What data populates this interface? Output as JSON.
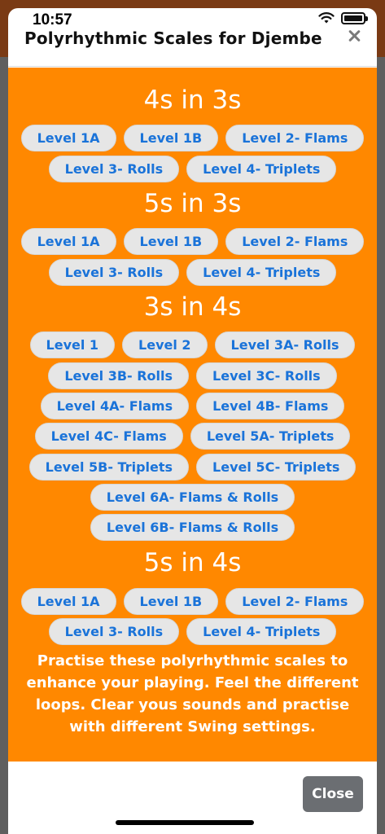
{
  "status": {
    "time": "10:57"
  },
  "modal": {
    "title": "Polyrhythmic Scales for Djembe",
    "close_label": "Close"
  },
  "sections": [
    {
      "title": "4s in 3s",
      "rows": [
        [
          "Level 1A",
          "Level 1B",
          "Level 2- Flams"
        ],
        [
          "Level 3- Rolls",
          "Level 4- Triplets"
        ]
      ]
    },
    {
      "title": "5s in 3s",
      "rows": [
        [
          "Level 1A",
          "Level 1B",
          "Level 2- Flams"
        ],
        [
          "Level 3- Rolls",
          "Level 4- Triplets"
        ]
      ]
    },
    {
      "title": "3s in 4s",
      "rows": [
        [
          "Level 1",
          "Level 2",
          "Level 3A- Rolls"
        ],
        [
          "Level 3B- Rolls",
          "Level 3C- Rolls"
        ],
        [
          "Level 4A- Flams",
          "Level 4B- Flams"
        ],
        [
          "Level 4C- Flams",
          "Level 5A- Triplets"
        ],
        [
          "Level 5B- Triplets",
          "Level 5C- Triplets"
        ],
        [
          "Level 6A- Flams & Rolls"
        ],
        [
          "Level 6B- Flams & Rolls"
        ]
      ]
    },
    {
      "title": "5s in 4s",
      "rows": [
        [
          "Level 1A",
          "Level 1B",
          "Level 2- Flams"
        ],
        [
          "Level 3- Rolls",
          "Level 4- Triplets"
        ]
      ]
    }
  ],
  "description": "Practise these polyrhythmic scales to enhance your playing. Feel the different loops. Clear yous sounds and practise with different Swing settings.",
  "colors": {
    "content_bg": "#ff8800",
    "pill_bg": "#e6e6e6",
    "pill_text": "#1a73d9",
    "close_button_bg": "#6b6e72"
  }
}
